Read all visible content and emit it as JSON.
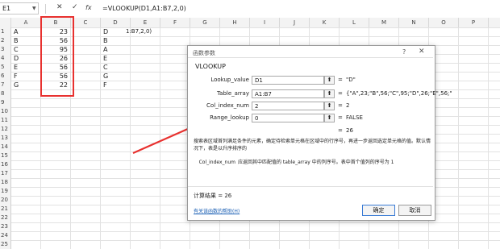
{
  "formula_bar": {
    "name_box": "E1",
    "cancel_symbol": "✕",
    "enter_symbol": "✓",
    "fx_symbol": "fx",
    "formula": "=VLOOKUP(D1,A1:B7,2,0)"
  },
  "columns": [
    "A",
    "B",
    "C",
    "D",
    "E",
    "F",
    "G",
    "H",
    "I",
    "J",
    "K",
    "L",
    "M",
    "N",
    "O",
    "P"
  ],
  "rows": [
    {
      "num": "1",
      "a": "A",
      "b": "23",
      "d": "D",
      "e": "1:B7,2,0)"
    },
    {
      "num": "2",
      "a": "B",
      "b": "56",
      "d": "B",
      "e": ""
    },
    {
      "num": "3",
      "a": "C",
      "b": "95",
      "d": "A",
      "e": ""
    },
    {
      "num": "4",
      "a": "D",
      "b": "26",
      "d": "E",
      "e": ""
    },
    {
      "num": "5",
      "a": "E",
      "b": "56",
      "d": "C",
      "e": ""
    },
    {
      "num": "6",
      "a": "F",
      "b": "56",
      "d": "G",
      "e": ""
    },
    {
      "num": "7",
      "a": "G",
      "b": "22",
      "d": "F",
      "e": ""
    },
    {
      "num": "8"
    },
    {
      "num": "9"
    },
    {
      "num": "10"
    },
    {
      "num": "11"
    },
    {
      "num": "12"
    },
    {
      "num": "13"
    },
    {
      "num": "14"
    },
    {
      "num": "15"
    },
    {
      "num": "16"
    },
    {
      "num": "17"
    },
    {
      "num": "18"
    },
    {
      "num": "19"
    },
    {
      "num": "20"
    },
    {
      "num": "21"
    },
    {
      "num": "22"
    },
    {
      "num": "23"
    },
    {
      "num": "24"
    },
    {
      "num": "25"
    }
  ],
  "dialog": {
    "title": "函数参数",
    "help_symbol": "?",
    "close_symbol": "✕",
    "function_name": "VLOOKUP",
    "args": [
      {
        "label": "Lookup_value",
        "value": "D1",
        "result": "\"D\""
      },
      {
        "label": "Table_array",
        "value": "A1:B7",
        "result": "{\"A\",23;\"B\",56;\"C\",95;\"D\",26;\"E\",56;\""
      },
      {
        "label": "Col_index_num",
        "value": "2",
        "result": "2"
      },
      {
        "label": "Range_lookup",
        "value": "0",
        "result": "FALSE"
      }
    ],
    "eq_sign": "=",
    "ref_button_symbol": "⬆",
    "overall_result": "26",
    "description": "搜索表区域首列满足条件的元素，确定待检索单元格在区域中的行序号，再进一步返回选定单元格的值。默认情况下，表是以升序排序的",
    "arg_name": "Col_index_num",
    "arg_description": "应返回其中匹配值的 table_array 中的列序号。表中首个值列的序号为 1",
    "calc_label": "计算结果 =",
    "calc_value": "26",
    "help_link": "有关该函数的帮助(H)",
    "ok_label": "确定",
    "cancel_label": "取消"
  },
  "colors": {
    "highlight": "#e8312f",
    "link": "#1a5fb4"
  }
}
